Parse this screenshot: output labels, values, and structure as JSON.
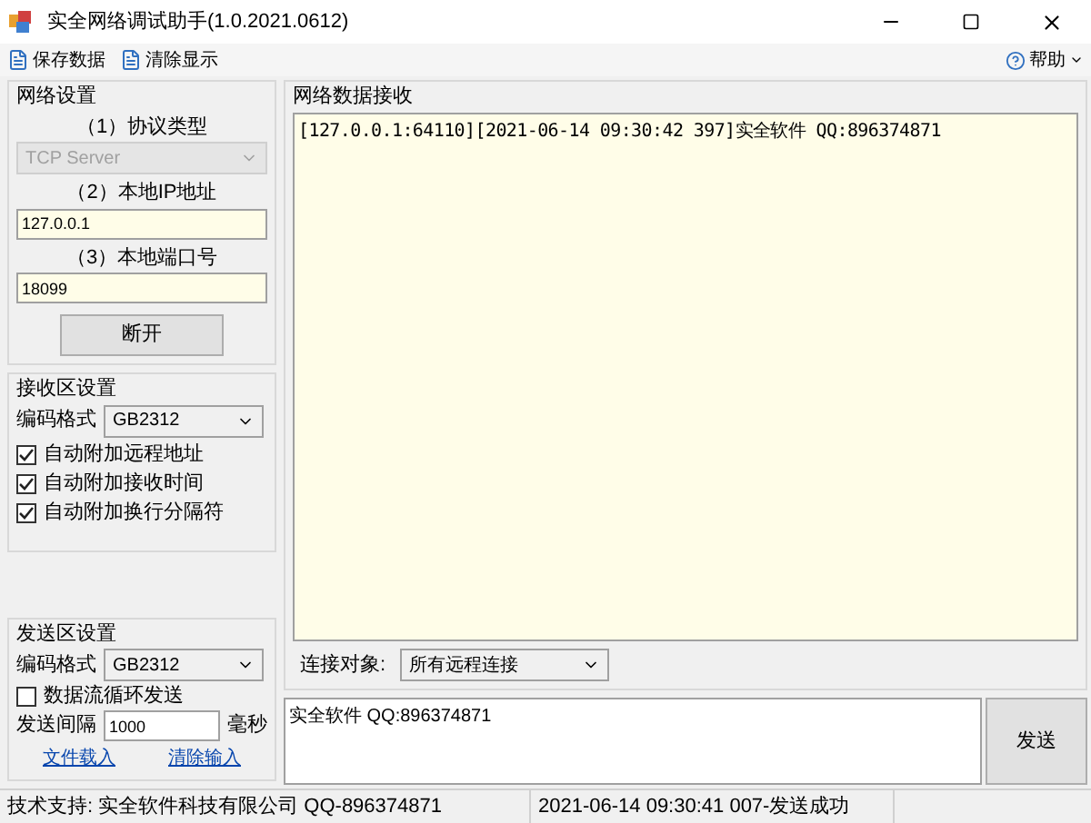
{
  "window": {
    "title": "实全网络调试助手(1.0.2021.0612)"
  },
  "toolbar": {
    "items": [
      {
        "label": "保存数据"
      },
      {
        "label": "清除显示"
      }
    ],
    "help": {
      "label": "帮助"
    }
  },
  "network_settings": {
    "title": "网络设置",
    "protocol_label": "（1）协议类型",
    "protocol": {
      "value": "TCP Server",
      "disabled": true
    },
    "ip_label": "（2）本地IP地址",
    "ip": "127.0.0.1",
    "port_label": "（3）本地端口号",
    "port": "18099",
    "connect_button": "断开"
  },
  "receive_settings": {
    "title": "接收区设置",
    "encoding_label": "编码格式",
    "encoding": "GB2312",
    "options": [
      {
        "label": "自动附加远程地址",
        "checked": true
      },
      {
        "label": "自动附加接收时间",
        "checked": true
      },
      {
        "label": "自动附加换行分隔符",
        "checked": true
      }
    ]
  },
  "send_settings": {
    "title": "发送区设置",
    "encoding_label": "编码格式",
    "encoding": "GB2312",
    "loop": {
      "label": "数据流循环发送",
      "checked": false
    },
    "interval_label": "发送间隔",
    "interval": "1000",
    "interval_unit": "毫秒",
    "links": [
      "文件载入",
      "清除输入"
    ]
  },
  "receive_area": {
    "title": "网络数据接收",
    "lines": [
      "[127.0.0.1:64110][2021-06-14 09:30:42 397]实全软件 QQ:896374871"
    ]
  },
  "target": {
    "label": "连接对象:",
    "value": "所有远程连接"
  },
  "send_area": {
    "value": "实全软件 QQ:896374871",
    "button": "发送"
  },
  "status_bar": [
    "技术支持: 实全软件科技有限公司 QQ-896374871",
    "2021-06-14 09:30:41 007-发送成功"
  ]
}
